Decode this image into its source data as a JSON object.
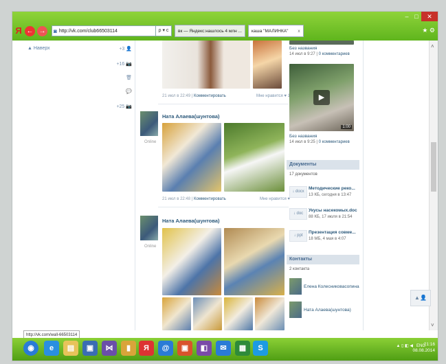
{
  "browser": {
    "window_controls": {
      "minimize": "–",
      "maximize": "□",
      "close": "✕"
    },
    "logo": "Я",
    "back_icon": "←",
    "forward_icon": "→",
    "address": "http://vk.com/club66503114",
    "address_tools": "ρ ▾ c",
    "tabs": [
      {
        "label": "вк — Яндекс:нашлось 4 млн ..."
      },
      {
        "label": "каша \"МАЛИНКА\"",
        "close": "x"
      }
    ],
    "topright_icons": "★ ⚙",
    "status_url": "http://vk.com/wall-66503114"
  },
  "left": {
    "up_label": "▲ Наверх",
    "counters": [
      "+3 👤",
      "+16 📷",
      "🗑",
      "💬",
      "+25 📷"
    ]
  },
  "feed": {
    "posts": [
      {
        "date": "21 июл в 22:49",
        "comment": "Комментировать",
        "like": "Мне нравится ♥ 1"
      },
      {
        "author": "Ната Алаева(шунтова)",
        "online": "Online",
        "date": "21 июл в 22:48",
        "comment": "Комментировать",
        "like": "Мне нравится ♥"
      },
      {
        "author": "Ната Алаева(шунтова)",
        "online": "Online"
      }
    ]
  },
  "right": {
    "videos": [
      {
        "title": "Без названия",
        "meta": "14 июл в 9:27",
        "comments": "0 комментариев"
      },
      {
        "title": "Без названия",
        "meta": "14 июл в 9:25",
        "comments": "0 комментариев",
        "duration": "1:00"
      }
    ],
    "documents_header": "Документы",
    "documents_count": "17 документов",
    "documents": [
      {
        "ext": "↓ docx",
        "title": "Методические реко...",
        "meta": "13 КБ, сегодня в 13:47"
      },
      {
        "ext": "↓ doc",
        "title": "Укусы насекомых.doc",
        "meta": "88 КБ, 17 июля в 21:54"
      },
      {
        "ext": "↓ ppt",
        "title": "Презентация совме...",
        "meta": "18 МБ, 4 мая в 4:07"
      }
    ],
    "contacts_header": "Контакты",
    "contacts_count": "2 контакта",
    "contacts": [
      {
        "name": "Елена Колесникoвасопина"
      },
      {
        "name": "Ната Алаева(шунтова)"
      }
    ]
  },
  "taskbar": {
    "tray_lang": "ENG",
    "tray_icons": "▲ ▯ ◧ ◀",
    "time": "21:16",
    "date": "08.08.2014"
  },
  "colors": {
    "accent": "#5fb51d",
    "link": "#2b587a",
    "vk_header": "#dae2ea"
  }
}
